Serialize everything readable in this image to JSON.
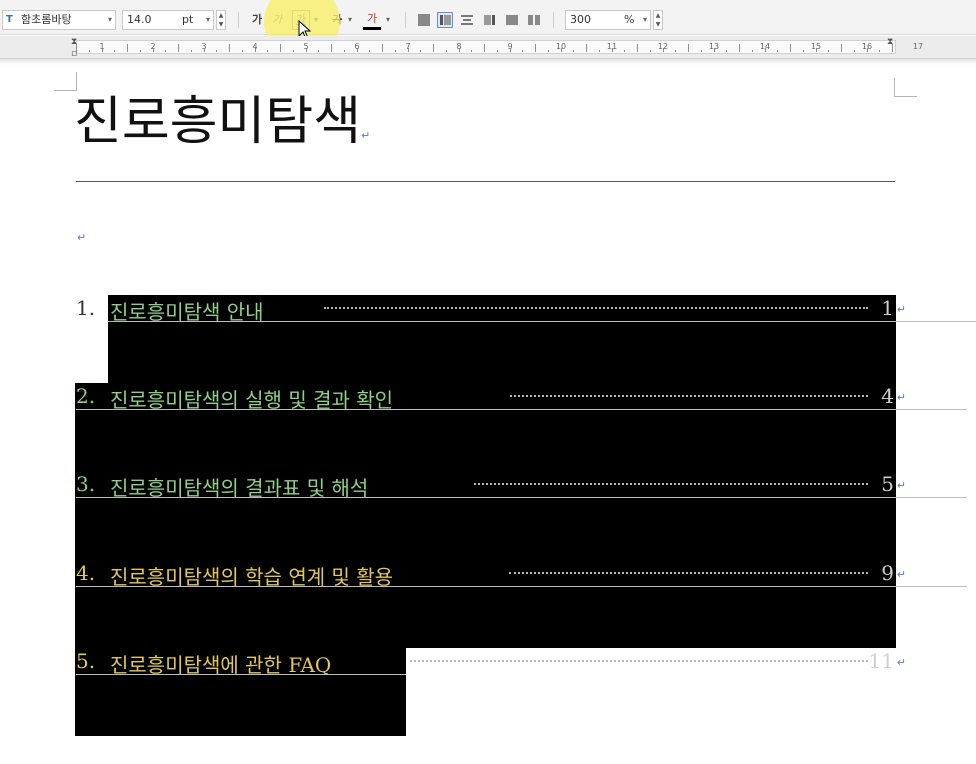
{
  "toolbar": {
    "font_name": "함초롬바탕",
    "font_size": "14.0",
    "font_unit": "pt",
    "bold": "가",
    "italic": "가",
    "underline": "가",
    "strike": "가",
    "font_color": "가",
    "zoom": "300",
    "zoom_unit": "%"
  },
  "ruler": {
    "numbers": [
      "1",
      "2",
      "3",
      "4",
      "5",
      "6",
      "7",
      "8",
      "9",
      "10",
      "11",
      "12",
      "13",
      "14",
      "15",
      "16",
      "17"
    ]
  },
  "document": {
    "title": "진로흥미탐색",
    "paragraph_mark": "↵",
    "toc": [
      {
        "number": "1.",
        "title": "진로흥미탐색 안내",
        "page": "1",
        "color": "#8ed084"
      },
      {
        "number": "2.",
        "title": "진로흥미탐색의 실행 및 결과 확인",
        "page": "4",
        "color": "#8ed084"
      },
      {
        "number": "3.",
        "title": "진로흥미탐색의 결과표 및 해석",
        "page": "5",
        "color": "#8ed084"
      },
      {
        "number": "4.",
        "title": "진로흥미탐색의 학습 연계 및 활용",
        "page": "9",
        "color": "#e0c85a"
      },
      {
        "number": "5.",
        "title": "진로흥미탐색에 관한 FAQ",
        "page": "11",
        "color": "#e0c85a"
      }
    ]
  },
  "colors": {
    "selection": "#000000",
    "paragraph_mark": "#5a7fc0",
    "highlight": "#f7ef5a"
  }
}
